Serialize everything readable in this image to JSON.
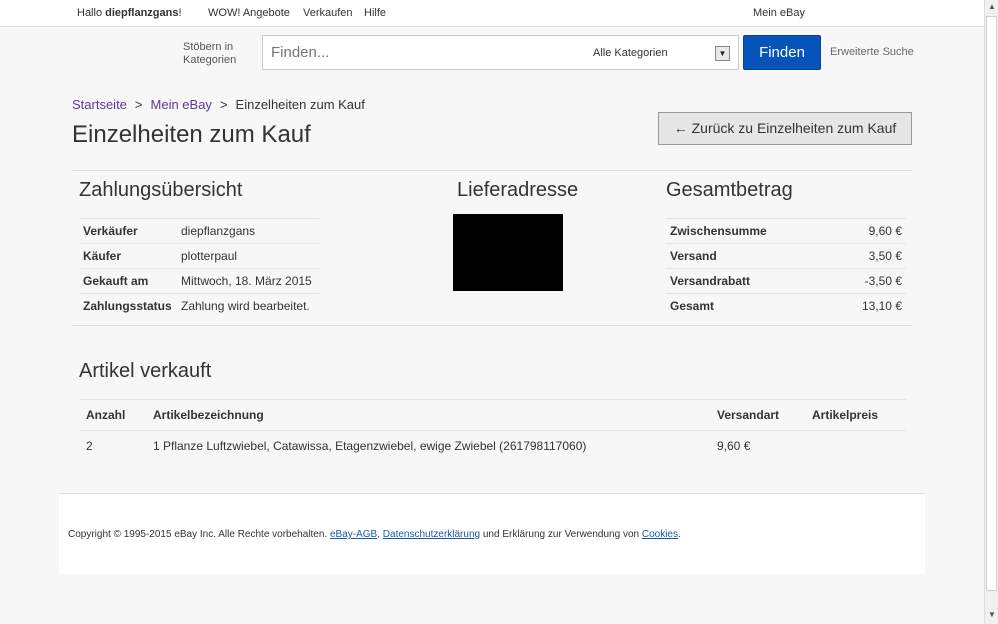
{
  "topbar": {
    "greeting": "Hallo ",
    "username": "diepflanzgans",
    "greeting_end": "!",
    "links": [
      "WOW! Angebote",
      "Verkaufen",
      "Hilfe"
    ],
    "my_ebay": "Mein eBay"
  },
  "search": {
    "browse_line1": "Stöbern in",
    "browse_line2": "Kategorien",
    "placeholder": "Finden...",
    "category": "Alle Kategorien",
    "button": "Finden",
    "advanced": "Erweiterte Suche"
  },
  "breadcrumb": [
    "Startseite",
    "Mein eBay",
    "Einzelheiten zum Kauf"
  ],
  "page": {
    "title": "Einzelheiten zum Kauf",
    "back_button": "← Zurück zu Einzelheiten zum Kauf"
  },
  "payment": {
    "title": "Zahlungsübersicht",
    "rows": [
      {
        "label": "Verkäufer",
        "value": "diepflanzgans"
      },
      {
        "label": "Käufer",
        "value": "plotterpaul"
      },
      {
        "label": "Gekauft am",
        "value": "Mittwoch, 18. März 2015"
      },
      {
        "label": "Zahlungsstatus",
        "value": "Zahlung wird bearbeitet."
      }
    ]
  },
  "shipping": {
    "title": "Lieferadresse"
  },
  "total": {
    "title": "Gesamtbetrag",
    "rows": [
      {
        "label": "Zwischensumme",
        "value": "9,60 €"
      },
      {
        "label": "Versand",
        "value": "3,50 €"
      },
      {
        "label": "Versandrabatt",
        "value": "-3,50 €"
      },
      {
        "label": "Gesamt",
        "value": "13,10 €"
      }
    ]
  },
  "items": {
    "title": "Artikel verkauft",
    "headers": [
      "Anzahl",
      "Artikelbezeichnung",
      "Versandart",
      "Artikelpreis"
    ],
    "rows": [
      {
        "qty": "2",
        "name": "1 Pflanze Luftzwiebel, Catawissa, Etagenzwiebel, ewige Zwiebel (261798117060)",
        "shipping": "9,60 €",
        "price": ""
      }
    ]
  },
  "footer": {
    "copyright": "Copyright © 1995-2015 eBay Inc. Alle Rechte vorbehalten. ",
    "agb": "eBay-AGB",
    "sep": ", ",
    "privacy": "Datenschutzerklärung",
    "middle": " und Erklärung zur Verwendung von ",
    "cookies": "Cookies",
    "end": "."
  }
}
